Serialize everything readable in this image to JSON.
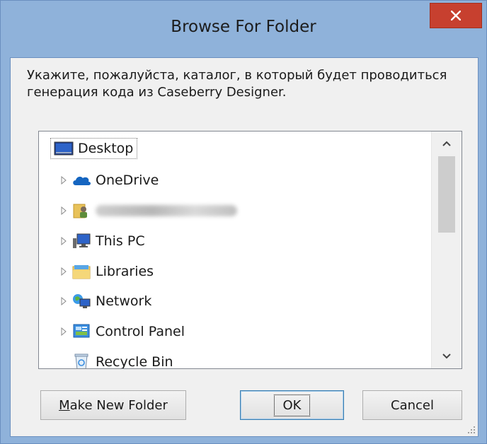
{
  "window": {
    "title": "Browse For Folder",
    "close_label": "✕"
  },
  "description": "Укажите, пожалуйста, каталог, в который будет проводиться генерация кода из Caseberry Designer.",
  "tree": {
    "items": [
      {
        "label": "Desktop",
        "icon": "desktop-icon",
        "expandable": false,
        "selected": true
      },
      {
        "label": "OneDrive",
        "icon": "onedrive-cloud-icon",
        "expandable": true
      },
      {
        "label": "",
        "icon": "user-folder-icon",
        "expandable": true,
        "note": "blurred"
      },
      {
        "label": "This PC",
        "icon": "this-pc-icon",
        "expandable": true
      },
      {
        "label": "Libraries",
        "icon": "libraries-icon",
        "expandable": true
      },
      {
        "label": "Network",
        "icon": "network-icon",
        "expandable": true
      },
      {
        "label": "Control Panel",
        "icon": "control-panel-icon",
        "expandable": true
      },
      {
        "label": "Recycle Bin",
        "icon": "recycle-bin-icon",
        "expandable": false
      }
    ]
  },
  "buttons": {
    "make_new_folder": "Make New Folder",
    "make_new_folder_mnemonic": "M",
    "make_new_folder_rest": "ake New Folder",
    "ok": "OK",
    "cancel": "Cancel"
  },
  "colors": {
    "frame": "#8fb2da",
    "close": "#c7402f",
    "client": "#f0f0f0"
  }
}
